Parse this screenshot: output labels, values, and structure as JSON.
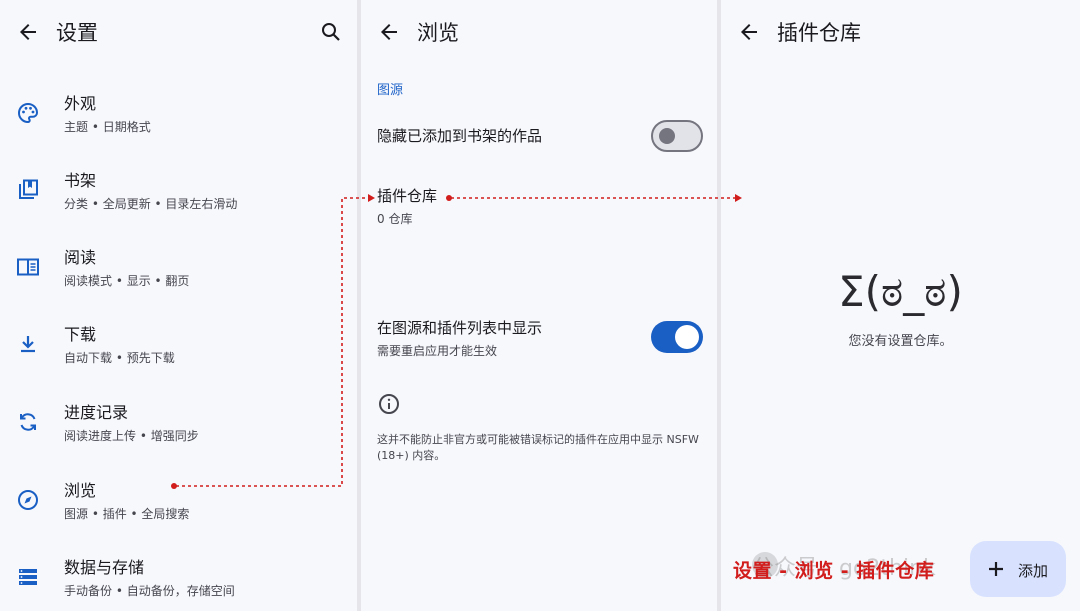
{
  "colors": {
    "accent": "#1a5fc4",
    "annotation": "#d21d1d",
    "background": "#f7f8fc"
  },
  "settings": {
    "title": "设置",
    "items": [
      {
        "icon": "palette-icon",
        "title": "外观",
        "subtitle": "主题 • 日期格式"
      },
      {
        "icon": "library-icon",
        "title": "书架",
        "subtitle": "分类 • 全局更新 • 目录左右滑动"
      },
      {
        "icon": "reader-icon",
        "title": "阅读",
        "subtitle": "阅读模式 • 显示 • 翻页"
      },
      {
        "icon": "download-icon",
        "title": "下载",
        "subtitle": "自动下载 • 预先下载"
      },
      {
        "icon": "sync-icon",
        "title": "进度记录",
        "subtitle": "阅读进度上传 • 增强同步"
      },
      {
        "icon": "compass-icon",
        "title": "浏览",
        "subtitle": "图源 • 插件 • 全局搜索"
      },
      {
        "icon": "storage-icon",
        "title": "数据与存储",
        "subtitle": "手动备份 • 自动备份，存储空间"
      }
    ]
  },
  "browse": {
    "title": "浏览",
    "section": "图源",
    "hide_in_library": {
      "label": "隐藏已添加到书架的作品",
      "enabled": false
    },
    "extension_repos": {
      "label": "插件仓库",
      "sub": "0 仓库"
    },
    "show_nsfw": {
      "label": "在图源和插件列表中显示",
      "sub": "需要重启应用才能生效",
      "enabled": true
    },
    "info": "这并不能防止非官方或可能被错误标记的插件在应用中显示 NSFW (18+) 内容。"
  },
  "repos": {
    "title": "插件仓库",
    "empty_face": "Σ(ಠ_ಠ)",
    "empty_message": "您没有设置仓库。",
    "fab_label": "添加"
  },
  "caption": "设置 - 浏览 - 插件仓库",
  "watermark": "公众号 · go2think"
}
